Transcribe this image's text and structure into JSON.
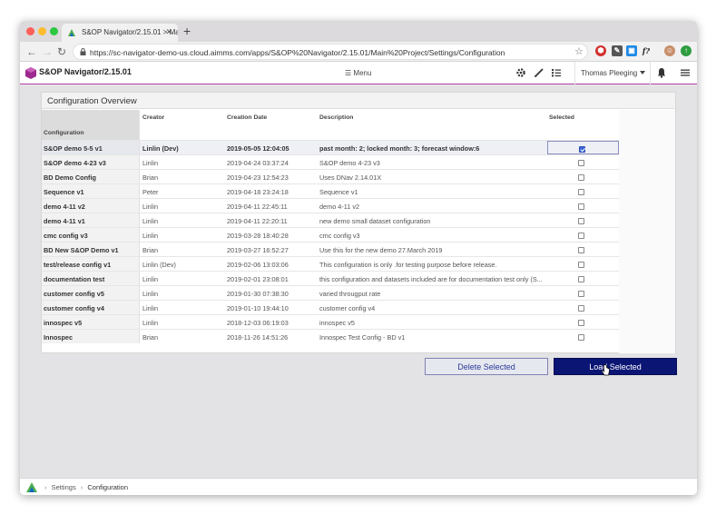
{
  "browser": {
    "tab_title": "S&OP Navigator/2.15.01 > Mai",
    "url": "https://sc-navigator-demo-us.cloud.aimms.com/apps/S&OP%20Navigator/2.15.01/Main%20Project/Settings/Configuration"
  },
  "app": {
    "title": "S&OP Navigator/2.15.01",
    "menu_label": "Menu",
    "user_name": "Thomas Pleeging",
    "accent_color": "#ac3aa0"
  },
  "panel": {
    "title": "Configuration Overview"
  },
  "grid": {
    "columns": {
      "name": "Configuration",
      "creator": "Creator",
      "date": "Creation Date",
      "description": "Description",
      "selected": "Selected"
    },
    "rows": [
      {
        "name": "S&OP demo 5-5 v1",
        "creator": "Linlin (Dev)",
        "date": "2019-05-05 12:04:05",
        "description": "past month: 2; locked month: 3; forecast window:6",
        "selected": true
      },
      {
        "name": "S&OP demo 4-23 v3",
        "creator": "Linlin",
        "date": "2019-04-24 03:37:24",
        "description": "S&OP demo 4-23 v3",
        "selected": false
      },
      {
        "name": "BD Demo Config",
        "creator": "Brian",
        "date": "2019-04-23 12:54:23",
        "description": "Uses DNav 2.14.01X",
        "selected": false
      },
      {
        "name": "Sequence v1",
        "creator": "Peter",
        "date": "2019-04-18 23:24:18",
        "description": "Sequence v1",
        "selected": false
      },
      {
        "name": "demo 4-11 v2",
        "creator": "Linlin",
        "date": "2019-04-11 22:45:11",
        "description": "demo 4-11 v2",
        "selected": false
      },
      {
        "name": "demo 4-11 v1",
        "creator": "Linlin",
        "date": "2019-04-11 22:20:11",
        "description": "new demo small dataset configuration",
        "selected": false
      },
      {
        "name": "cmc config v3",
        "creator": "Linlin",
        "date": "2019-03-28 18:40:28",
        "description": "cmc config v3",
        "selected": false
      },
      {
        "name": "BD New S&OP Demo v1",
        "creator": "Brian",
        "date": "2019-03-27 16:52:27",
        "description": "Use this for the new demo 27.March 2019",
        "selected": false
      },
      {
        "name": "test/release config v1",
        "creator": "Linlin (Dev)",
        "date": "2019-02-06 13:03:06",
        "description": "This configuration is only .for testing purpose before release.",
        "selected": false
      },
      {
        "name": "documentation test",
        "creator": "Linlin",
        "date": "2019-02-01 23:08:01",
        "description": "this configuration and datasets included are for documentation test only (S...",
        "selected": false
      },
      {
        "name": "customer config v5",
        "creator": "Linlin",
        "date": "2019-01-30 07:38:30",
        "description": "varied througput rate",
        "selected": false
      },
      {
        "name": "customer config v4",
        "creator": "Linlin",
        "date": "2019-01-10 19:44:10",
        "description": "customer config v4",
        "selected": false
      },
      {
        "name": "innospec v5",
        "creator": "Linlin",
        "date": "2018-12-03 06:19:03",
        "description": "innospec v5",
        "selected": false
      },
      {
        "name": "Innospec",
        "creator": "Brian",
        "date": "2018-11-26 14:51:26",
        "description": "Innospec Test Config - BD v1",
        "selected": false
      }
    ]
  },
  "buttons": {
    "delete_label": "Delete Selected",
    "load_label": "Load Selected"
  },
  "footer": {
    "crumb_settings": "Settings",
    "crumb_current": "Configuration"
  },
  "icons": {
    "gear": "gear-icon",
    "pencil": "pencil-icon",
    "list": "list-icon",
    "bell": "bell-icon",
    "hamburger": "hamburger-icon"
  }
}
